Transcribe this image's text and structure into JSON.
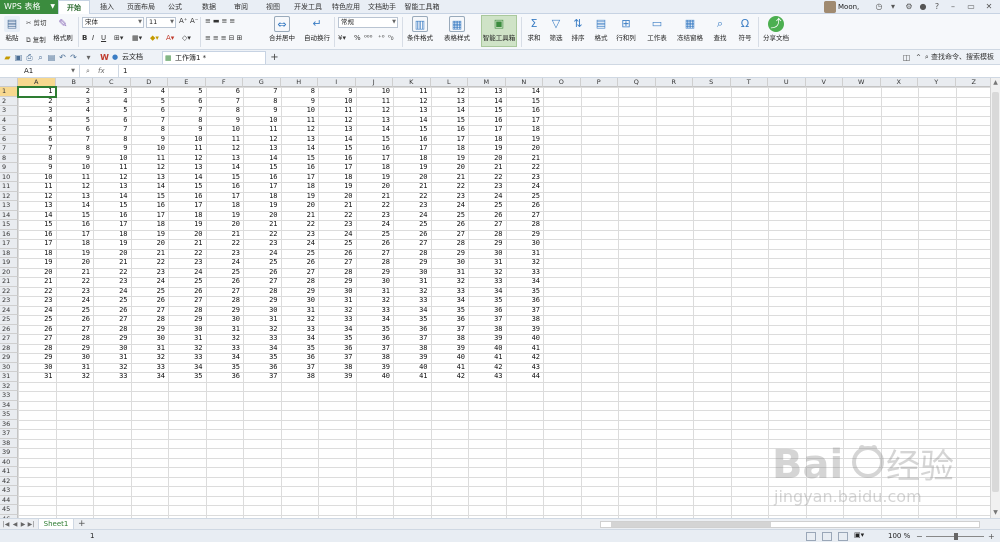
{
  "app": {
    "brand": "WPS 表格",
    "user": "Moon,",
    "menu_tabs": [
      "开始",
      "插入",
      "页面布局",
      "公式",
      "数据",
      "审阅",
      "视图",
      "开发工具",
      "特色应用",
      "文档助手",
      "智能工具箱"
    ],
    "active_tab": "开始"
  },
  "ribbon": {
    "paste": "粘贴",
    "cut": "剪切",
    "copy": "复制",
    "format_painter": "格式刷",
    "font_name": "宋体",
    "font_size": "11",
    "merge_center": "合并居中",
    "auto_wrap": "自动换行",
    "number_format": "常规",
    "conditional_format": "条件格式",
    "table_style": "表格样式",
    "smart_toolbox": "智能工具箱",
    "sum": "求和",
    "filter": "筛选",
    "sort": "排序",
    "format": "格式",
    "rows_cols": "行和列",
    "worksheet": "工作表",
    "freeze": "冻结窗格",
    "find": "查找",
    "symbol": "符号",
    "share": "分享文档"
  },
  "tabbar": {
    "cloud_doc": "云文档",
    "workbook_tab": "工作簿1 *",
    "search_cmd": "查找命令、搜索模板"
  },
  "formula_bar": {
    "cell_ref": "A1",
    "fx": "fx",
    "value": "1"
  },
  "grid": {
    "columns": [
      "A",
      "B",
      "C",
      "D",
      "E",
      "F",
      "G",
      "H",
      "I",
      "J",
      "K",
      "L",
      "M",
      "N",
      "O",
      "P",
      "Q",
      "R",
      "S",
      "T",
      "U",
      "V",
      "W",
      "X",
      "Y",
      "Z"
    ],
    "row_count": 46,
    "filled_rows": 31,
    "filled_cols": 14,
    "rule": "cell(row r, col c) = r + c - 1 for r in 1..31, c in 1..14"
  },
  "sheets": [
    "Sheet1"
  ],
  "status": {
    "value": "1",
    "zoom": "100 %"
  },
  "colors": {
    "brand_green": "#3b8c3e",
    "active_cell_border": "#2e7d32",
    "header_highlight": "#f7d88f"
  }
}
